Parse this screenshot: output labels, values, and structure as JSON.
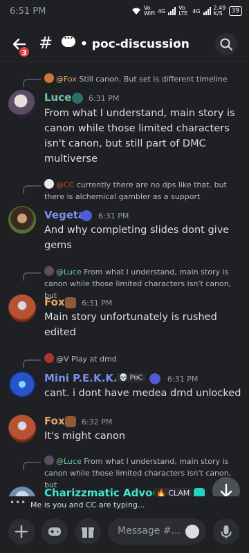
{
  "status": {
    "time": "6:51 PM",
    "carrier1": "Vo WiFi",
    "net1": "4G",
    "carrier2": "Vo LTE",
    "net2": "4G",
    "speed": "2.49 K/S",
    "battery": "39"
  },
  "header": {
    "unread_count": "3",
    "channel_name": "• poc-discussion",
    "icons": [
      "back-arrow-icon",
      "hash-icon",
      "speech-bubble-icon",
      "chevron-right-icon",
      "search-icon"
    ]
  },
  "messages": [
    {
      "reply": {
        "name": "@Fox",
        "text": "Still canon. But set is different timeline"
      },
      "author": "Luce",
      "author_color": "#71c6a6",
      "time": "6:31 PM",
      "body": "From what I understand, main story is canon while those limited characters isn't canon, but still part of DMC multiverse"
    },
    {
      "reply": {
        "name": "@CC",
        "text": "currently there are no dps like that.  but there is alchemical gambler as a support"
      },
      "author": "Vegeta",
      "author_color": "#7c8ef0",
      "time": "6:31 PM",
      "body": "And why completing slides dont give gems"
    },
    {
      "reply": {
        "name": "@Luce",
        "text": "From what I understand, main story is canon while those limited characters isn't canon, but"
      },
      "author": "Fox",
      "author_color": "#e2a86c",
      "time": "6:31 PM",
      "body": "Main story unfortunately is rushed edited"
    },
    {
      "reply": {
        "name": "@V",
        "text": "Play at dmd"
      },
      "author": "Mini P.E.K.K.A",
      "author_color": "#7c8ef0",
      "tag": "PoC",
      "time": "6:31 PM",
      "body": "cant. i dont have medea dmd unlocked"
    },
    {
      "author": "Fox",
      "author_color": "#e2a86c",
      "time": "6:32 PM",
      "body": "It's might canon"
    },
    {
      "reply": {
        "name": "@Luce",
        "text": "From what I understand, main story is canon while those limited characters isn't canon, but"
      },
      "author": "Charizzmatic Advoc...",
      "author_color": "#3ee8d2",
      "tag": "CLAM"
    }
  ],
  "typing": {
    "text": "Me is you and CC are typing..."
  },
  "composer": {
    "placeholder": "Message #..."
  },
  "colors": {
    "bg": "#1f2024",
    "accent": "#5865f2",
    "badge": "#e23d3f"
  }
}
